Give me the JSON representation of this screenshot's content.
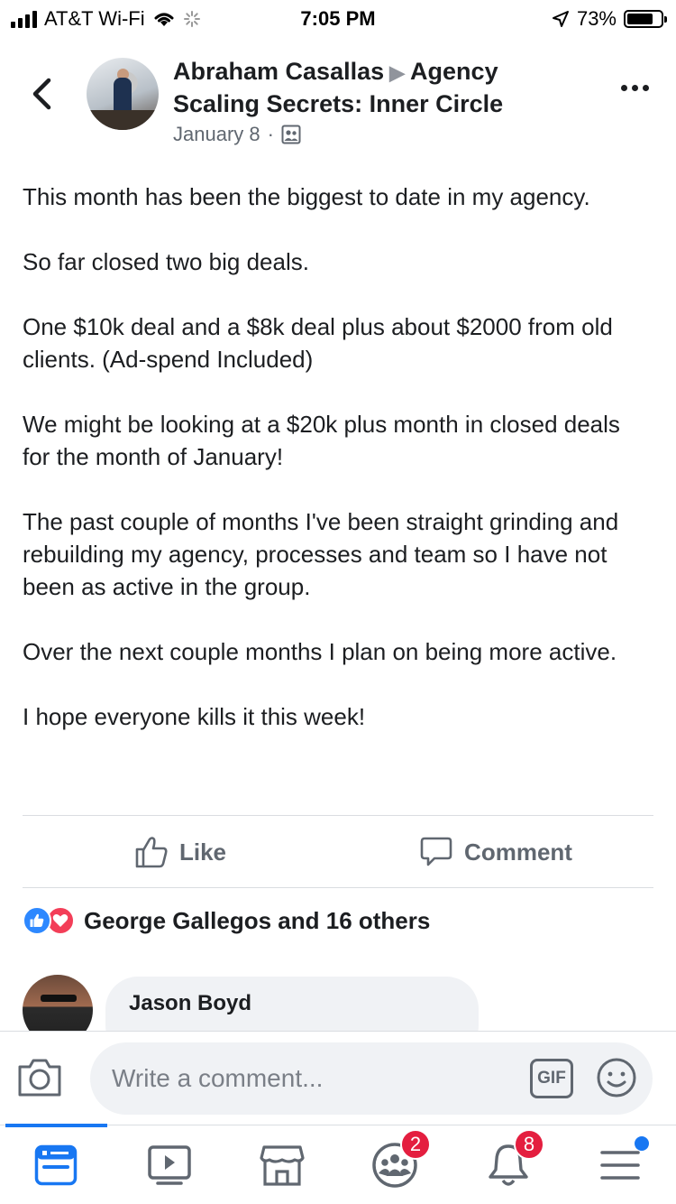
{
  "status_bar": {
    "carrier": "AT&T Wi-Fi",
    "time": "7:05 PM",
    "battery": "73%"
  },
  "post": {
    "author": "Abraham Casallas",
    "group": "Agency Scaling Secrets: Inner Circle",
    "date": "January 8",
    "paragraphs": [
      "This month has been the biggest to date in my agency.",
      "So far closed two big deals.",
      "One $10k deal and a $8k deal plus about $2000 from old clients. (Ad-spend Included)",
      "We might be looking at a $20k plus month in closed deals for the month of January!",
      "The past couple of months I've been straight grinding and rebuilding my agency, processes and team so I have not been as active in the group.",
      "Over the next couple months I plan on being more active.",
      "I hope everyone kills it this week!"
    ]
  },
  "actions": {
    "like_label": "Like",
    "comment_label": "Comment"
  },
  "reactions": {
    "summary": "George Gallegos and 16 others"
  },
  "comment_preview": {
    "name": "Jason Boyd"
  },
  "composer": {
    "placeholder": "Write a comment...",
    "gif_label": "GIF"
  },
  "tab_bar": {
    "groups_badge": "2",
    "notifications_badge": "8"
  },
  "colors": {
    "accent": "#1877f2",
    "badge": "#e41e3f",
    "love": "#f33e58"
  }
}
